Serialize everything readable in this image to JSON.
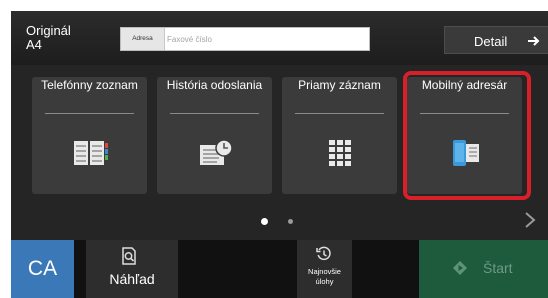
{
  "header": {
    "original_label": "Originál",
    "paper_size": "A4",
    "address_tag": "Adresa",
    "address_placeholder": "Faxové číslo",
    "detail_label": "Detail"
  },
  "tiles": [
    {
      "label": "Telefónny zoznam",
      "icon": "address-book-icon"
    },
    {
      "label": "História odoslania",
      "icon": "send-history-icon"
    },
    {
      "label": "Priamy záznam",
      "icon": "keypad-icon"
    },
    {
      "label": "Mobilný adresár",
      "icon": "mobile-phonebook-icon",
      "highlighted": true
    }
  ],
  "pagination": {
    "current_page": 1,
    "total_pages": 2
  },
  "bottom": {
    "ca_label": "CA",
    "preview_label": "Náhľad",
    "jobs_label_line1": "Najnovšie",
    "jobs_label_line2": "úlohy",
    "start_label": "Štart"
  },
  "colors": {
    "ca_blue": "#3b78b8",
    "start_green": "#1e5a3c",
    "highlight_red": "#d8202a",
    "mobile_icon_blue": "#3a9ad9"
  }
}
